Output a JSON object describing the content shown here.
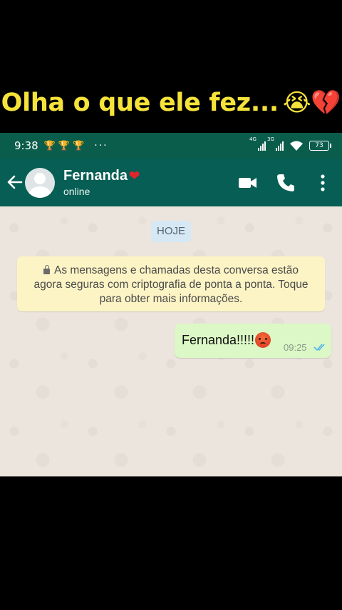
{
  "caption": {
    "text": "Olha o que ele fez...",
    "emoji": "😭💔"
  },
  "status_bar": {
    "time": "9:38",
    "left_icons": "🏆🏆🏆",
    "more_dots": "···",
    "signal1_label": "4G",
    "signal2_label": "3G",
    "battery": "73"
  },
  "header": {
    "contact_name": "Fernanda",
    "name_emoji": "❤",
    "status": "online",
    "icons": [
      "back-arrow-icon",
      "avatar",
      "video-call-icon",
      "phone-icon",
      "more-vert-icon"
    ]
  },
  "chat": {
    "date_label": "HOJE",
    "encryption_notice": {
      "line1": "As mensagens e chamadas desta conversa estão",
      "line2": "agora seguras com criptografia de ponta a ponta. Toque",
      "line3": "para obter mais informações."
    },
    "messages": [
      {
        "text": "Fernanda!!!!!",
        "emoji": "angry-face",
        "time": "09:25",
        "status": "read"
      }
    ]
  },
  "colors": {
    "header": "#075e54",
    "status_bar": "#0b5d4b",
    "chat_bg": "#ece5dd",
    "outgoing_bubble": "#dcf8c6",
    "notice_bg": "#fdf4c5",
    "caption_text": "#f6e33a",
    "read_ticks": "#4fb6ec"
  }
}
